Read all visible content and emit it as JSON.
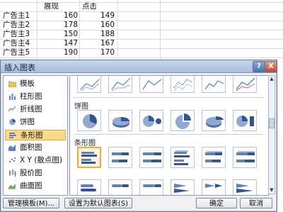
{
  "sheet": {
    "headers": [
      "展现",
      "点击"
    ],
    "rows": [
      {
        "name": "广告主1",
        "impressions": "160",
        "clicks": "149"
      },
      {
        "name": "广告主2",
        "impressions": "178",
        "clicks": "160"
      },
      {
        "name": "广告主3",
        "impressions": "150",
        "clicks": "188"
      },
      {
        "name": "广告主4",
        "impressions": "147",
        "clicks": "167"
      },
      {
        "name": "广告主5",
        "impressions": "190",
        "clicks": "170"
      }
    ]
  },
  "dialog": {
    "title": "插入图表",
    "help_label": "?",
    "close_label": "X",
    "sidebar": [
      {
        "label": "模板",
        "icon": "folder-icon",
        "selected": false
      },
      {
        "label": "柱形图",
        "icon": "column-chart-icon",
        "selected": false
      },
      {
        "label": "折线图",
        "icon": "line-chart-icon",
        "selected": false
      },
      {
        "label": "饼图",
        "icon": "pie-chart-icon",
        "selected": false
      },
      {
        "label": "条形图",
        "icon": "bar-chart-icon",
        "selected": true
      },
      {
        "label": "面积图",
        "icon": "area-chart-icon",
        "selected": false
      },
      {
        "label": "X Y (散点图)",
        "icon": "scatter-chart-icon",
        "selected": false
      },
      {
        "label": "股价图",
        "icon": "stock-chart-icon",
        "selected": false
      },
      {
        "label": "曲面图",
        "icon": "surface-chart-icon",
        "selected": false
      }
    ],
    "sections": {
      "pie": "饼图",
      "bar": "条形图"
    },
    "buttons": {
      "manage_templates": "管理模板(M)...",
      "set_default": "设置为默认图表(S)",
      "ok": "确定",
      "cancel": "取消"
    },
    "colors": {
      "selected_fill": "#ffd98a",
      "selected_border": "#e8a537",
      "chart_blue": "#5f83b8"
    }
  }
}
